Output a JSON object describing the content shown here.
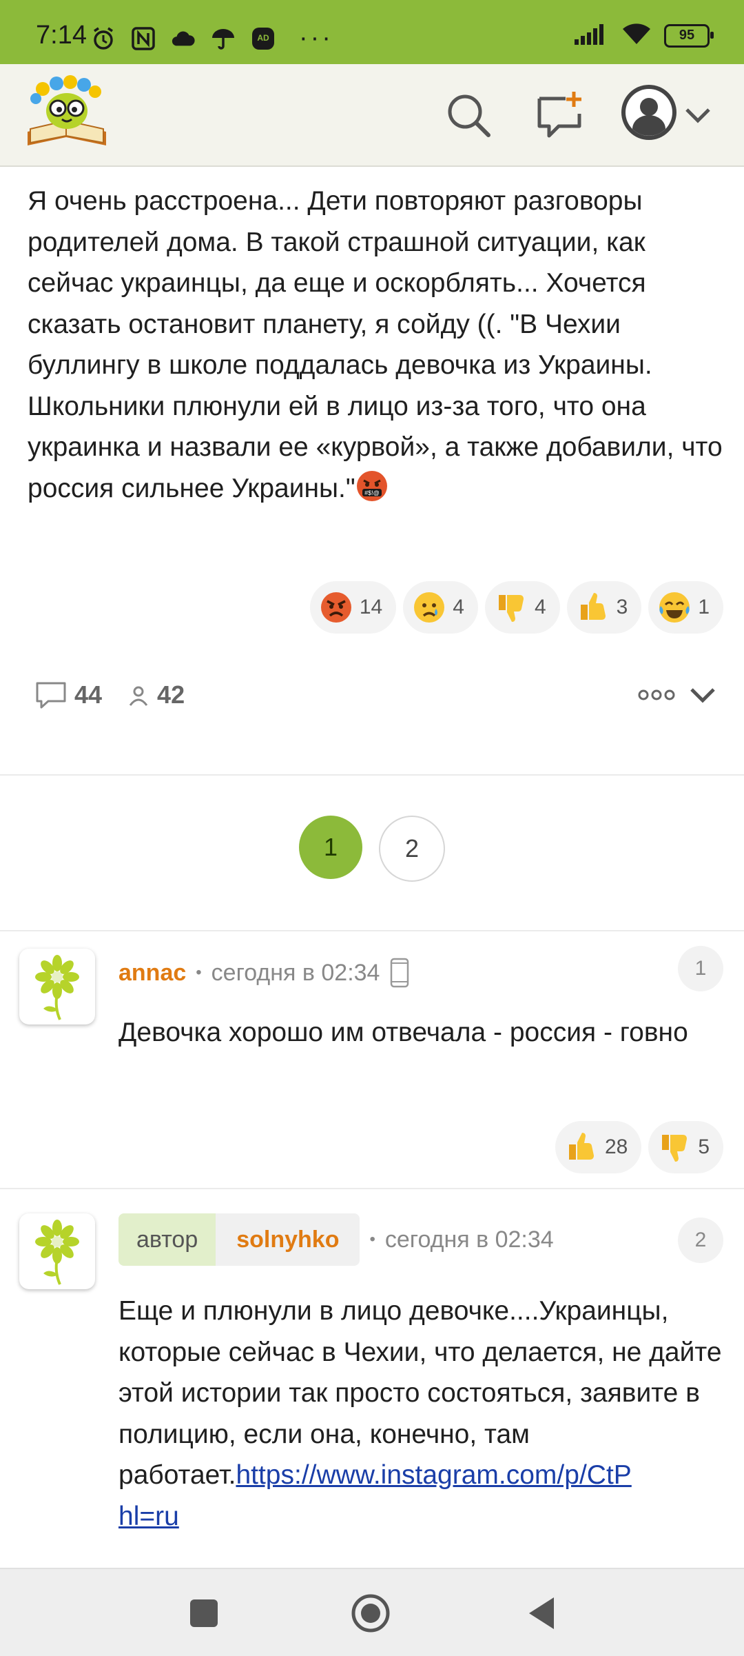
{
  "status_bar": {
    "time": "7:14",
    "battery": "95",
    "icons": [
      "alarm-icon",
      "nfc-icon",
      "cloud-icon",
      "umbrella-icon",
      "adblock-icon",
      "more-dots-icon",
      "signal-icon",
      "wifi-icon",
      "battery-icon"
    ],
    "more": "···"
  },
  "header": {
    "logo": "sun-book-logo",
    "icons": [
      "search-icon",
      "new-topic-icon",
      "user-avatar-icon",
      "chevron-down-icon"
    ]
  },
  "post": {
    "text": "Я очень расстроена... Дети повторяют разговоры родителей дома. В такой страшной ситуации, как сейчас украинцы, да еще и оскорблять... Хочется сказать остановит планету, я сойду ((. \"В Чехии буллингу в школе поддалась девочка из Украины. Школьники плюнули ей в лицо из-за того, что она украинка и назвали ее «курвой», а также добавили, что россия сильнее Украины.\"",
    "trailing_emoji": "cursing-face-icon",
    "reactions": [
      {
        "icon": "angry-face-icon",
        "count": "14"
      },
      {
        "icon": "crying-face-icon",
        "count": "4"
      },
      {
        "icon": "thumbs-down-icon",
        "count": "4"
      },
      {
        "icon": "thumbs-up-icon",
        "count": "3"
      },
      {
        "icon": "tears-of-joy-icon",
        "count": "1"
      }
    ],
    "comments_count": "44",
    "participants_count": "42"
  },
  "pagination": {
    "pages": [
      "1",
      "2"
    ],
    "current": "1"
  },
  "comments": [
    {
      "author": "annac",
      "separator": "•",
      "time": "сегодня в 02:34",
      "device_icon": "mobile-phone-icon",
      "number": "1",
      "text": "Девочка хорошо им отвечала - россия - говно",
      "reactions": [
        {
          "icon": "thumbs-up-icon",
          "count": "28"
        },
        {
          "icon": "thumbs-down-icon",
          "count": "5"
        }
      ]
    },
    {
      "author_label": "автор",
      "author": "solnyhko",
      "separator": "•",
      "time": "сегодня в 02:34",
      "number": "2",
      "text": "Еще и плюнули в лицо девочке....Украинцы, которые сейчас в Чехии, что делается, не дайте этой истории так просто состояться, заявите в полицию, если она, конечно, там работает.",
      "link": "https://www.instagram.com/p/CtP",
      "link_tail": "hl=ru"
    }
  ],
  "nav_bar": {
    "icons": [
      "recents-square-icon",
      "home-circle-icon",
      "back-triangle-icon"
    ]
  }
}
